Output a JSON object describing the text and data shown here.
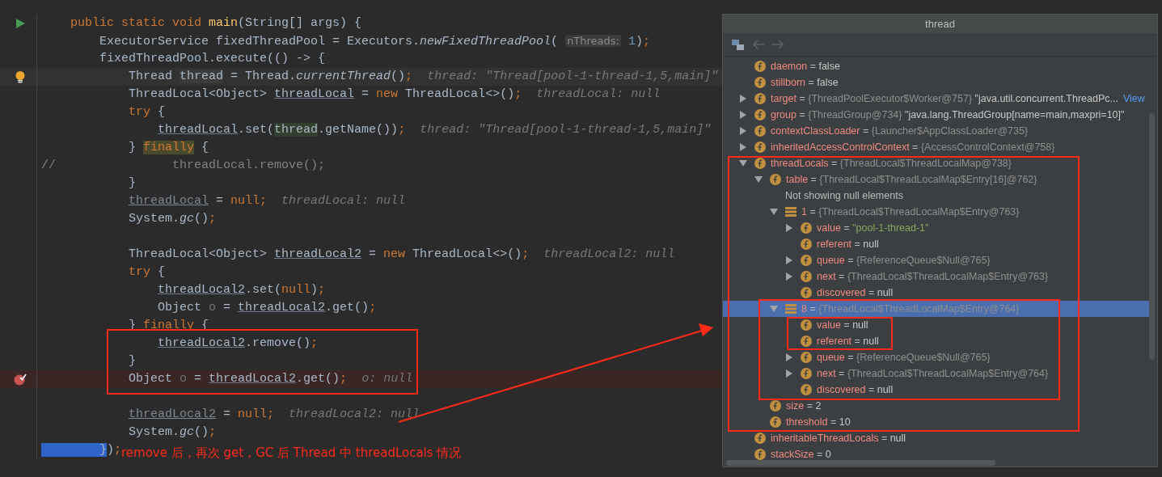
{
  "editor": {
    "lines": [
      {
        "kind": "run",
        "tokens": [
          {
            "kind": "kw",
            "text": "    public static void "
          },
          {
            "kind": "fn",
            "text": "main"
          },
          {
            "kind": "txt",
            "text": "(String[] args) {"
          }
        ]
      },
      {
        "kind": "normal",
        "tokens": [
          {
            "kind": "txt",
            "text": "        ExecutorService fixedThreadPool = Executors."
          },
          {
            "kind": "static",
            "text": "newFixedThreadPool"
          },
          {
            "kind": "txt",
            "text": "( "
          },
          {
            "kind": "param",
            "text": "nThreads:"
          },
          {
            "kind": "num",
            "text": " 1"
          },
          {
            "kind": "txt",
            "text": ")"
          },
          {
            "kind": "kw",
            "text": ";"
          }
        ]
      },
      {
        "kind": "normal",
        "tokens": [
          {
            "kind": "txt",
            "text": "        fixedThreadPool.execute(() -> {"
          }
        ]
      },
      {
        "kind": "current",
        "tokens": [
          {
            "kind": "txt",
            "text": "            Thread "
          },
          {
            "kind": "decl",
            "text": "thread"
          },
          {
            "kind": "txt",
            "text": " = Thread."
          },
          {
            "kind": "static",
            "text": "currentThread"
          },
          {
            "kind": "txt",
            "text": "()"
          },
          {
            "kind": "kw",
            "text": ";"
          },
          {
            "kind": "hint",
            "text": "  thread: \"Thread[pool-1-thread-1,5,main]\""
          }
        ]
      },
      {
        "kind": "normal",
        "tokens": [
          {
            "kind": "txt",
            "text": "            ThreadLocal<Object> "
          },
          {
            "kind": "var",
            "text": "threadLocal"
          },
          {
            "kind": "txt",
            "text": " = "
          },
          {
            "kind": "kw",
            "text": "new "
          },
          {
            "kind": "txt",
            "text": "ThreadLocal<>()"
          },
          {
            "kind": "kw",
            "text": ";"
          },
          {
            "kind": "hint",
            "text": "  threadLocal: null"
          }
        ]
      },
      {
        "kind": "normal",
        "tokens": [
          {
            "kind": "kw",
            "text": "            try "
          },
          {
            "kind": "txt",
            "text": "{"
          }
        ]
      },
      {
        "kind": "normal",
        "tokens": [
          {
            "kind": "var",
            "text": "                threadLocal"
          },
          {
            "kind": "txt",
            "text": ".set("
          },
          {
            "kind": "ref",
            "text": "thread"
          },
          {
            "kind": "txt",
            "text": ".getName())"
          },
          {
            "kind": "kw",
            "text": ";"
          },
          {
            "kind": "hint",
            "text": "  thread: \"Thread[pool-1-thread-1,5,main]\""
          }
        ]
      },
      {
        "kind": "normal",
        "tokens": [
          {
            "kind": "txt",
            "text": "            } "
          },
          {
            "kind": "fin",
            "text": "finally"
          },
          {
            "kind": "txt",
            "text": " {"
          }
        ]
      },
      {
        "kind": "normal",
        "tokens": [
          {
            "kind": "comment",
            "text": "//                threadLocal.remove();"
          }
        ]
      },
      {
        "kind": "normal",
        "tokens": [
          {
            "kind": "txt",
            "text": "            }"
          }
        ]
      },
      {
        "kind": "normal",
        "tokens": [
          {
            "kind": "dimvar",
            "text": "            threadLocal"
          },
          {
            "kind": "txt",
            "text": " = "
          },
          {
            "kind": "kw",
            "text": "null;"
          },
          {
            "kind": "hint",
            "text": "  threadLocal: null"
          }
        ]
      },
      {
        "kind": "normal",
        "tokens": [
          {
            "kind": "txt",
            "text": "            System."
          },
          {
            "kind": "static",
            "text": "gc"
          },
          {
            "kind": "txt",
            "text": "()"
          },
          {
            "kind": "kw",
            "text": ";"
          }
        ]
      },
      {
        "kind": "normal"
      },
      {
        "kind": "normal",
        "tokens": [
          {
            "kind": "txt",
            "text": "            ThreadLocal<Object> "
          },
          {
            "kind": "var",
            "text": "threadLocal2"
          },
          {
            "kind": "txt",
            "text": " = "
          },
          {
            "kind": "kw",
            "text": "new "
          },
          {
            "kind": "txt",
            "text": "ThreadLocal<>()"
          },
          {
            "kind": "kw",
            "text": ";"
          },
          {
            "kind": "hint",
            "text": "  threadLocal2: null"
          }
        ]
      },
      {
        "kind": "normal",
        "tokens": [
          {
            "kind": "kw",
            "text": "            try "
          },
          {
            "kind": "txt",
            "text": "{"
          }
        ]
      },
      {
        "kind": "normal",
        "tokens": [
          {
            "kind": "var",
            "text": "                threadLocal2"
          },
          {
            "kind": "txt",
            "text": ".set("
          },
          {
            "kind": "kw",
            "text": "null"
          },
          {
            "kind": "txt",
            "text": ")"
          },
          {
            "kind": "kw",
            "text": ";"
          }
        ]
      },
      {
        "kind": "normal",
        "tokens": [
          {
            "kind": "txt",
            "text": "                Object "
          },
          {
            "kind": "unused",
            "text": "o"
          },
          {
            "kind": "txt",
            "text": " = "
          },
          {
            "kind": "var",
            "text": "threadLocal2"
          },
          {
            "kind": "txt",
            "text": ".get()"
          },
          {
            "kind": "kw",
            "text": ";"
          }
        ]
      },
      {
        "kind": "normal",
        "tokens": [
          {
            "kind": "txt",
            "text": "            } "
          },
          {
            "kind": "kw",
            "text": "finally"
          },
          {
            "kind": "txt",
            "text": " {"
          }
        ]
      },
      {
        "kind": "normal",
        "tokens": [
          {
            "kind": "var",
            "text": "                threadLocal2"
          },
          {
            "kind": "txt",
            "text": ".remove()"
          },
          {
            "kind": "kw",
            "text": ";"
          }
        ]
      },
      {
        "kind": "normal",
        "tokens": [
          {
            "kind": "txt",
            "text": "            }"
          }
        ]
      },
      {
        "kind": "breakpoint",
        "tokens": [
          {
            "kind": "txt",
            "text": "            Object "
          },
          {
            "kind": "unused",
            "text": "o"
          },
          {
            "kind": "txt",
            "text": " = "
          },
          {
            "kind": "var",
            "text": "threadLocal2"
          },
          {
            "kind": "txt",
            "text": ".get()"
          },
          {
            "kind": "kw",
            "text": ";"
          },
          {
            "kind": "hint",
            "text": "  o: null"
          }
        ]
      },
      {
        "kind": "normal"
      },
      {
        "kind": "normal",
        "tokens": [
          {
            "kind": "dimvar",
            "text": "            threadLocal2"
          },
          {
            "kind": "txt",
            "text": " = "
          },
          {
            "kind": "kw",
            "text": "null;"
          },
          {
            "kind": "hint",
            "text": "  threadLocal2: null"
          }
        ]
      },
      {
        "kind": "normal",
        "tokens": [
          {
            "kind": "txt",
            "text": "            System."
          },
          {
            "kind": "static",
            "text": "gc"
          },
          {
            "kind": "txt",
            "text": "()"
          },
          {
            "kind": "kw",
            "text": ";"
          }
        ]
      },
      {
        "kind": "normal",
        "tokens": [
          {
            "kind": "sel",
            "text": "        }"
          },
          {
            "kind": "txt",
            "text": ")"
          },
          {
            "kind": "kw",
            "text": ";"
          }
        ]
      }
    ]
  },
  "annotation": {
    "text": "remove 后，再次 get，GC 后 Thread 中 threadLocals 情况"
  },
  "popup": {
    "title": "thread",
    "tree": [
      {
        "kind": "field",
        "selected": false,
        "name": "daemon",
        "operator": "=",
        "value": "false"
      },
      {
        "kind": "field",
        "selected": false,
        "name": "stillborn",
        "operator": "=",
        "value": "false"
      },
      {
        "kind": "field",
        "expanded": false,
        "selected": false,
        "name": "target",
        "operator": "=",
        "object": "{ThreadPoolExecutor$Worker@757}",
        "value": "\"java.util.concurrent.ThreadPc...",
        "link": "View"
      },
      {
        "kind": "field",
        "expanded": false,
        "selected": false,
        "name": "group",
        "operator": "=",
        "object": "{ThreadGroup@734}",
        "value": "\"java.lang.ThreadGroup[name=main,maxpri=10]\""
      },
      {
        "kind": "field",
        "expanded": false,
        "selected": false,
        "name": "contextClassLoader",
        "operator": "=",
        "object": "{Launcher$AppClassLoader@735}"
      },
      {
        "kind": "field",
        "expanded": false,
        "selected": false,
        "name": "inheritedAccessControlContext",
        "operator": "=",
        "object": "{AccessControlContext@758}"
      },
      {
        "kind": "field",
        "expanded": true,
        "selected": false,
        "name": "threadLocals",
        "operator": "=",
        "object": "{ThreadLocal$ThreadLocalMap@738}",
        "children": [
          {
            "kind": "field",
            "expanded": true,
            "selected": false,
            "name": "table",
            "operator": "=",
            "object": "{ThreadLocal$ThreadLocalMap$Entry[16]@762}",
            "children": [
              {
                "kind": "note",
                "selected": false,
                "name": "Not showing null elements"
              },
              {
                "kind": "entry",
                "expanded": true,
                "selected": false,
                "name": "1",
                "operator": "=",
                "object": "{ThreadLocal$ThreadLocalMap$Entry@763}",
                "children": [
                  {
                    "kind": "field",
                    "expanded": false,
                    "selected": false,
                    "name": "value",
                    "operator": "=",
                    "string": "\"pool-1-thread-1\""
                  },
                  {
                    "kind": "field",
                    "selected": false,
                    "name": "referent",
                    "operator": "=",
                    "value": "null"
                  },
                  {
                    "kind": "field",
                    "expanded": false,
                    "selected": false,
                    "name": "queue",
                    "operator": "=",
                    "object": "{ReferenceQueue$Null@765}"
                  },
                  {
                    "kind": "field",
                    "expanded": false,
                    "selected": false,
                    "name": "next",
                    "operator": "=",
                    "object": "{ThreadLocal$ThreadLocalMap$Entry@763}"
                  },
                  {
                    "kind": "field",
                    "selected": false,
                    "name": "discovered",
                    "operator": "=",
                    "value": "null"
                  }
                ]
              },
              {
                "kind": "entry",
                "expanded": true,
                "selected": true,
                "name": "8",
                "operator": "=",
                "object": "{ThreadLocal$ThreadLocalMap$Entry@764}",
                "children": [
                  {
                    "kind": "field",
                    "selected": false,
                    "name": "value",
                    "operator": "=",
                    "value": "null"
                  },
                  {
                    "kind": "field",
                    "selected": false,
                    "name": "referent",
                    "operator": "=",
                    "value": "null"
                  },
                  {
                    "kind": "field",
                    "expanded": false,
                    "selected": false,
                    "name": "queue",
                    "operator": "=",
                    "object": "{ReferenceQueue$Null@765}"
                  },
                  {
                    "kind": "field",
                    "expanded": false,
                    "selected": false,
                    "name": "next",
                    "operator": "=",
                    "object": "{ThreadLocal$ThreadLocalMap$Entry@764}"
                  },
                  {
                    "kind": "field",
                    "selected": false,
                    "name": "discovered",
                    "operator": "=",
                    "value": "null"
                  }
                ]
              }
            ]
          },
          {
            "kind": "field",
            "selected": false,
            "name": "size",
            "operator": "=",
            "value": "2"
          },
          {
            "kind": "field",
            "selected": false,
            "name": "threshold",
            "operator": "=",
            "value": "10"
          }
        ]
      },
      {
        "kind": "field",
        "selected": false,
        "name": "inheritableThreadLocals",
        "operator": "=",
        "value": "null"
      },
      {
        "kind": "field",
        "selected": false,
        "name": "stackSize",
        "operator": "=",
        "value": "0"
      }
    ]
  }
}
